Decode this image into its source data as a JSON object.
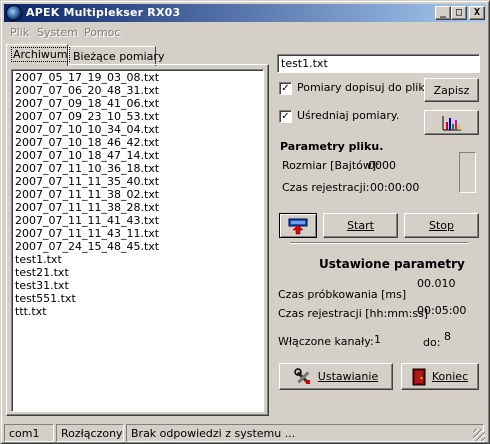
{
  "window": {
    "title": "APEK Multiplekser  RX03",
    "controls": {
      "minimize": "_",
      "maximize": "□",
      "close": "X"
    }
  },
  "menu": [
    "Plik",
    "System",
    "Pomoc"
  ],
  "tabs": [
    {
      "label": "Archiwum",
      "active": true
    },
    {
      "label": "Bieżące pomiary",
      "active": false
    }
  ],
  "files": [
    "2007_05_17_19_03_08.txt",
    "2007_07_06_20_48_31.txt",
    "2007_07_09_18_41_06.txt",
    "2007_07_09_23_10_53.txt",
    "2007_07_10_10_34_04.txt",
    "2007_07_10_18_46_42.txt",
    "2007_07_10_18_47_14.txt",
    "2007_07_11_10_36_18.txt",
    "2007_07_11_11_35_40.txt",
    "2007_07_11_11_38_02.txt",
    "2007_07_11_11_38_28.txt",
    "2007_07_11_11_41_43.txt",
    "2007_07_11_11_43_11.txt",
    "2007_07_24_15_48_45.txt",
    "test1.txt",
    "test21.txt",
    "test31.txt",
    "test551.txt",
    "ttt.txt"
  ],
  "right": {
    "filename_value": "test1.txt",
    "append_checkbox": {
      "label": "Pomiary dopisuj do pliku:",
      "checked": true
    },
    "average_checkbox": {
      "label": "Uśredniaj pomiary.",
      "checked": true
    },
    "save_button": "Zapisz",
    "chart_icon": "bar-chart-icon",
    "params_title": "Parametry pliku.",
    "size_label": "Rozmiar [Bajtów]:",
    "size_value": "0000",
    "rec_time_label": "Czas rejestracji:",
    "rec_time_value": "00:00:00",
    "start_button": "Start",
    "stop_button": "Stop",
    "settings_title": "Ustawione parametry",
    "sampling_label": "Czas próbkowania [ms]",
    "sampling_value": "00.010",
    "reg_time_label": "Czas rejestracji [hh:mm:ss]",
    "reg_time_value": "00:05:00",
    "channels_label": "Włączone kanały:",
    "channels_from": "1",
    "channels_to_label": "do:",
    "channels_to": "8",
    "settings_button": "Ustawianie",
    "exit_button": "Koniec"
  },
  "status": {
    "port": "com1",
    "connection": "Rozłączony",
    "message": "Brak odpowiedzi z systemu ..."
  },
  "colors": {
    "title_start": "#0a246a",
    "title_end": "#a6caf0",
    "face": "#d4d0c8"
  }
}
